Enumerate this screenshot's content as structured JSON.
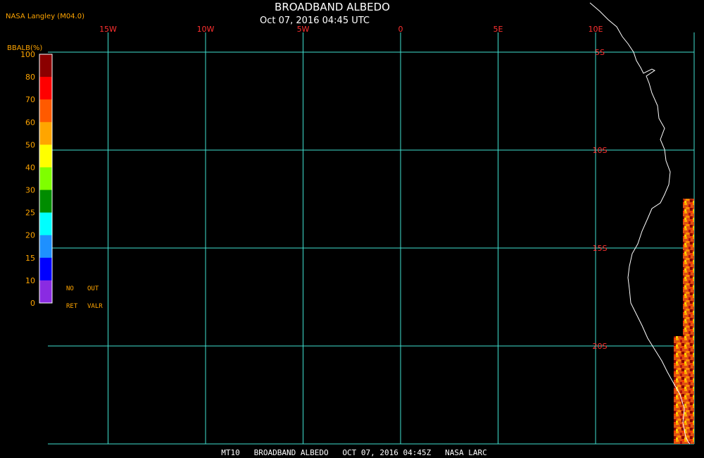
{
  "header": {
    "source": "NASA Langley (M04.0)",
    "title": "BROADBAND ALBEDO",
    "datetime": "Oct 07, 2016 04:45 UTC"
  },
  "footer": {
    "caption": "MT10   BROADBAND ALBEDO   OCT 07, 2016 04:45Z   NASA LARC"
  },
  "legend": {
    "unit_label": "BBALB(%)",
    "ticks": [
      "100",
      "80",
      "70",
      "60",
      "50",
      "40",
      "30",
      "25",
      "20",
      "15",
      "10",
      "0"
    ],
    "colors": [
      "#8b0000",
      "#ff0000",
      "#ff5a00",
      "#ffa500",
      "#ffff00",
      "#7fff00",
      "#008c00",
      "#00ffff",
      "#1e90ff",
      "#0000ff",
      "#8a2be2"
    ],
    "no_ret": [
      "NO",
      "RET"
    ],
    "out_valr": [
      "OUT",
      "VALR"
    ]
  },
  "grid": {
    "color": "#40e0d0",
    "label_color": "#ff3030",
    "longitudes": [
      {
        "value": -15,
        "label": "15W"
      },
      {
        "value": -10,
        "label": "10W"
      },
      {
        "value": -5,
        "label": "5W"
      },
      {
        "value": 0,
        "label": "0"
      },
      {
        "value": 5,
        "label": "5E"
      },
      {
        "value": 10,
        "label": "10E"
      }
    ],
    "latitudes": [
      {
        "value": -5,
        "label": "5S"
      },
      {
        "value": -10,
        "label": "10S"
      },
      {
        "value": -15,
        "label": "15S"
      },
      {
        "value": -20,
        "label": "20S"
      }
    ]
  },
  "map": {
    "coast_color": "#ffffff"
  }
}
